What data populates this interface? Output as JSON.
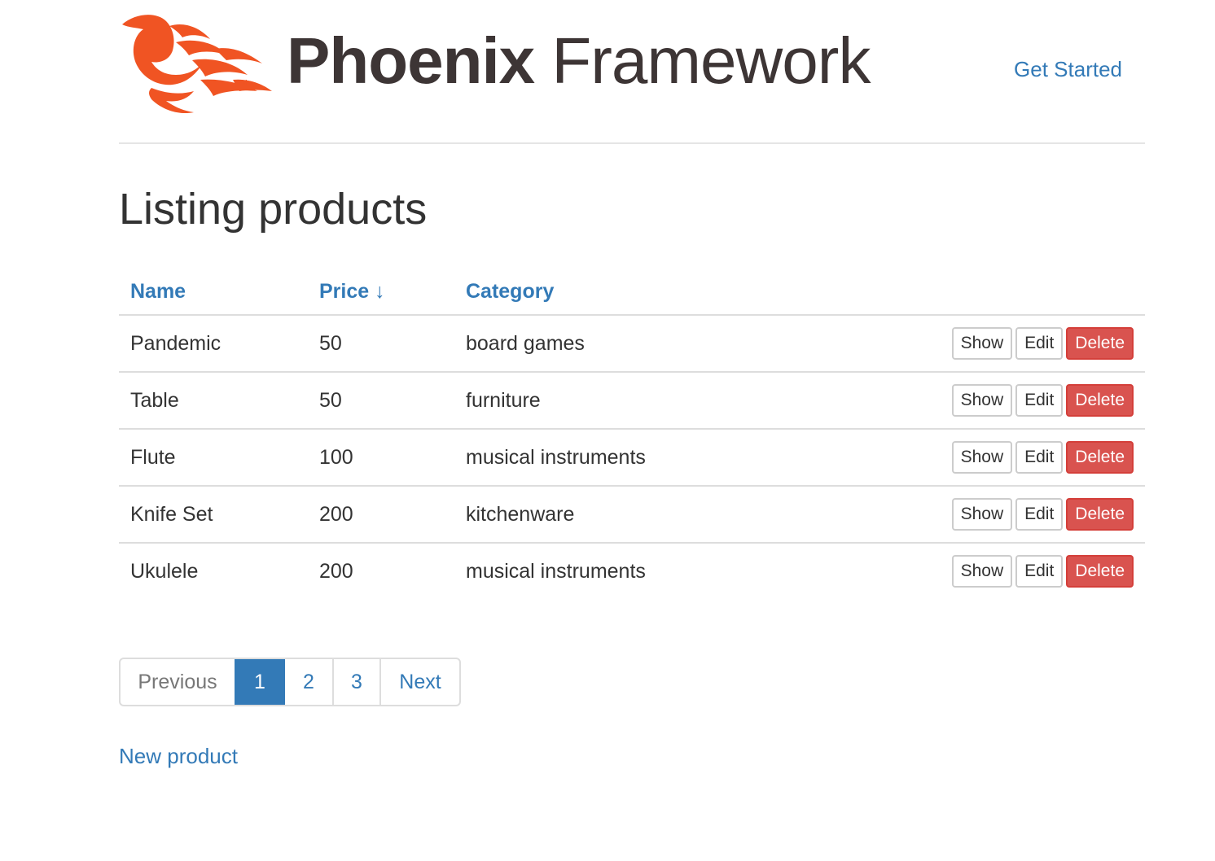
{
  "header": {
    "brand_bold": "Phoenix",
    "brand_light": " Framework",
    "nav_link": "Get Started",
    "logo_icon": "phoenix-logo-icon",
    "brand_color": "#f05423"
  },
  "page": {
    "title": "Listing products"
  },
  "table": {
    "columns": [
      "Name",
      "Price ↓",
      "Category"
    ],
    "rows": [
      {
        "name": "Pandemic",
        "price": "50",
        "category": "board games"
      },
      {
        "name": "Table",
        "price": "50",
        "category": "furniture"
      },
      {
        "name": "Flute",
        "price": "100",
        "category": "musical instruments"
      },
      {
        "name": "Knife Set",
        "price": "200",
        "category": "kitchenware"
      },
      {
        "name": "Ukulele",
        "price": "200",
        "category": "musical instruments"
      }
    ],
    "actions": {
      "show": "Show",
      "edit": "Edit",
      "delete": "Delete"
    },
    "delete_color": "#d9534f",
    "link_color": "#337ab7"
  },
  "pagination": {
    "previous": "Previous",
    "pages": [
      "1",
      "2",
      "3"
    ],
    "current": "1",
    "next": "Next"
  },
  "footer": {
    "new_product": "New product"
  }
}
